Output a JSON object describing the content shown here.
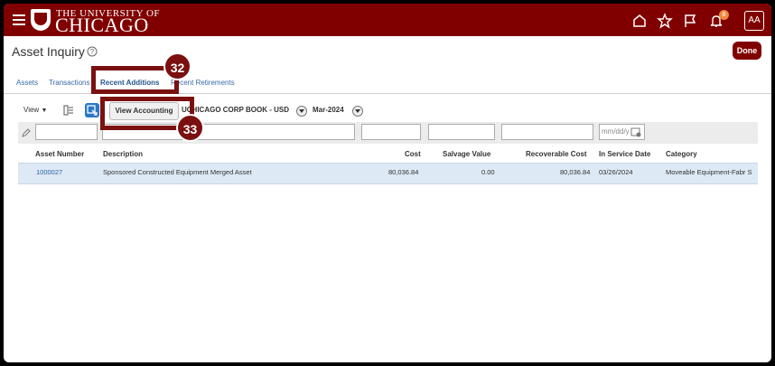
{
  "header": {
    "logo_small": "THE UNIVERSITY OF",
    "logo_big": "CHICAGO",
    "notification_count": "8",
    "avatar_initials": "AA"
  },
  "page": {
    "title": "Asset Inquiry",
    "done_label": "Done"
  },
  "tabs": [
    {
      "label": "Assets"
    },
    {
      "label": "Transactions"
    },
    {
      "label": "Recent Additions"
    },
    {
      "label": "Recent Retirements"
    }
  ],
  "toolbar": {
    "view_label": "View",
    "view_accounting_label": "View Accounting",
    "book": "UCHICAGO CORP BOOK - USD",
    "period": "Mar-2024"
  },
  "filter": {
    "date_placeholder": "mm/dd/y"
  },
  "table": {
    "columns": [
      "Asset Number",
      "Description",
      "Cost",
      "Salvage Value",
      "Recoverable Cost",
      "In Service Date",
      "Category"
    ],
    "rows": [
      {
        "asset_number": "1000027",
        "description": "Sponsored Constructed Equipment Merged Asset",
        "cost": "80,036.84",
        "salvage_value": "0.00",
        "recoverable_cost": "80,036.84",
        "in_service_date": "03/26/2024",
        "category": "Moveable Equipment-Fabr S"
      }
    ]
  },
  "callouts": [
    {
      "number": "32"
    },
    {
      "number": "33"
    }
  ],
  "colors": {
    "brand": "#800000",
    "callout": "#7a1010",
    "link": "#2a5ea8",
    "selected_row": "#dde9f5"
  }
}
